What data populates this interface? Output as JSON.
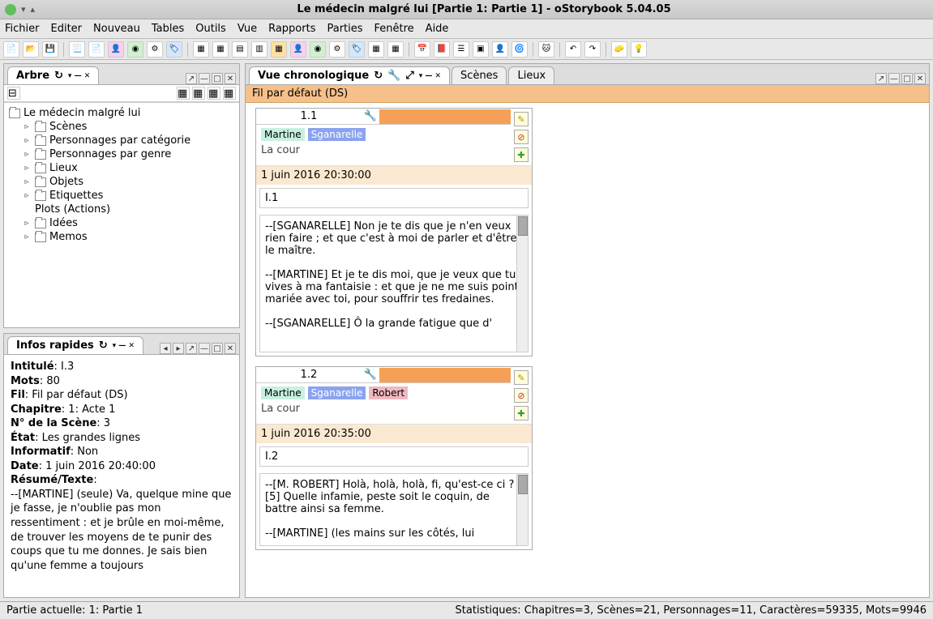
{
  "window": {
    "title": "Le médecin malgré lui [Partie 1: Partie 1] - oStorybook 5.04.05"
  },
  "menu": {
    "items": [
      "Fichier",
      "Editer",
      "Nouveau",
      "Tables",
      "Outils",
      "Vue",
      "Rapports",
      "Parties",
      "Fenêtre",
      "Aide"
    ]
  },
  "arbre": {
    "title": "Arbre",
    "root": "Le médecin malgré lui",
    "items": [
      "Scènes",
      "Personnages par catégorie",
      "Personnages par genre",
      "Lieux",
      "Objets",
      "Etiquettes",
      "Plots (Actions)",
      "Idées",
      "Memos"
    ]
  },
  "info": {
    "title": "Infos rapides",
    "intitule_l": "Intitulé",
    "intitule": ": I.3",
    "mots_l": "Mots",
    "mots": ": 80",
    "fil_l": "Fil",
    "fil": ": Fil par défaut (DS)",
    "chap_l": "Chapitre",
    "chap": ": 1: Acte 1",
    "num_l": "N° de la Scène",
    "num": ": 3",
    "etat_l": "État",
    "etat": ": Les grandes lignes",
    "inform_l": "Informatif",
    "inform": ": Non",
    "date_l": "Date",
    "date": ": 1 juin 2016 20:40:00",
    "resume_l": "Résumé/Texte",
    "resume": "--[MARTINE] (seule) Va, quelque mine que je fasse, je n'oublie pas mon ressentiment : et je brûle en moi-même, de trouver les moyens de te punir des coups que tu me donnes. Je sais bien qu'une femme a toujours"
  },
  "chrono": {
    "title": "Vue chronologique",
    "tabs": {
      "scenes": "Scènes",
      "lieux": "Lieux"
    },
    "strand": "Fil par défaut (DS)"
  },
  "scene1": {
    "num": "1.1",
    "tags": {
      "a": "Martine",
      "b": "Sganarelle"
    },
    "loc": "La cour",
    "date": "1 juin 2016 20:30:00",
    "id": "I.1",
    "text": "--[SGANARELLE] Non je te dis que je n'en veux rien faire ; et que c'est à moi de parler et d'être le maître.\n\n--[MARTINE] Et je te dis moi, que je veux que tu vives à ma fantaisie : et que je ne me suis point mariée avec toi, pour souffrir tes fredaines.\n\n--[SGANARELLE] Ô la grande fatigue que d'"
  },
  "scene2": {
    "num": "1.2",
    "tags": {
      "a": "Martine",
      "b": "Sganarelle",
      "c": "Robert"
    },
    "loc": "La cour",
    "date": "1 juin 2016 20:35:00",
    "id": "I.2",
    "text": "--[M. ROBERT] Holà, holà, holà, fi, qu'est-ce ci ? [5] Quelle infamie, peste soit le coquin, de battre ainsi sa femme.\n\n--[MARTINE] (les mains sur les côtés, lui"
  },
  "status": {
    "part": "Partie actuelle: 1: Partie 1",
    "stats": "Statistiques: Chapitres=3,  Scènes=21,  Personnages=11,  Caractères=59335,  Mots=9946"
  }
}
